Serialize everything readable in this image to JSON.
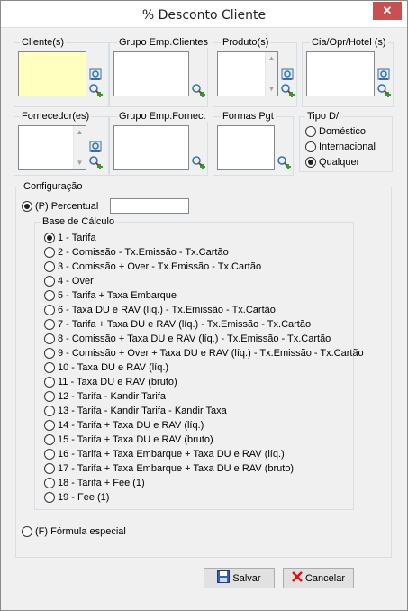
{
  "window": {
    "title": "% Desconto Cliente",
    "close_glyph": "✕"
  },
  "filters": {
    "clientes": "Cliente(s)",
    "grupo_emp_clientes": "Grupo Emp.Clientes",
    "produtos": "Produto(s)",
    "cia_opr_hotel": "Cia/Opr/Hotel (s)",
    "fornecedores": "Fornecedor(es)",
    "grupo_emp_fornec": "Grupo Emp.Fornec.",
    "formas_pgt": "Formas Pgt"
  },
  "tipo": {
    "label": "Tipo D/I",
    "options": [
      "Doméstico",
      "Internacional",
      "Qualquer"
    ],
    "selected": "Qualquer"
  },
  "configuracao": {
    "label": "Configuração",
    "percentual_label": "(P) Percentual",
    "percentual_value": "",
    "base_label": "Base de Cálculo",
    "base_options": [
      "1 - Tarifa",
      "2 - Comissão - Tx.Emissão - Tx.Cartão",
      "3 - Comissão + Over - Tx.Emissão - Tx.Cartão",
      "4 - Over",
      "5 - Tarifa + Taxa Embarque",
      "6 - Taxa DU e RAV (líq.) - Tx.Emissão - Tx.Cartão",
      "7 - Tarifa + Taxa DU e RAV (líq.) - Tx.Emissão - Tx.Cartão",
      "8 - Comissão + Taxa DU e RAV (líq.) - Tx.Emissão - Tx.Cartão",
      "9 - Comissão + Over + Taxa DU e RAV (líq.) - Tx.Emissão - Tx.Cartão",
      "10 - Taxa DU e RAV (líq.)",
      "11 - Taxa DU e RAV (bruto)",
      "12 - Tarifa - Kandir Tarifa",
      "13 - Tarifa - Kandir Tarifa - Kandir Taxa",
      "14 - Tarifa + Taxa DU e RAV (líq.)",
      "15 - Tarifa + Taxa DU e RAV (bruto)",
      "16 - Tarifa + Taxa Embarque + Taxa DU e RAV (líq.)",
      "17 - Tarifa + Taxa Embarque + Taxa DU e RAV (bruto)",
      "18 - Tarifa + Fee (1)",
      "19 - Fee (1)"
    ],
    "base_selected": "1 - Tarifa",
    "formula_label": "(F) Fórmula especial"
  },
  "buttons": {
    "save": "Salvar",
    "cancel": "Cancelar"
  },
  "colors": {
    "selected_listbox": "#ffffc0",
    "close": "#c75050"
  }
}
